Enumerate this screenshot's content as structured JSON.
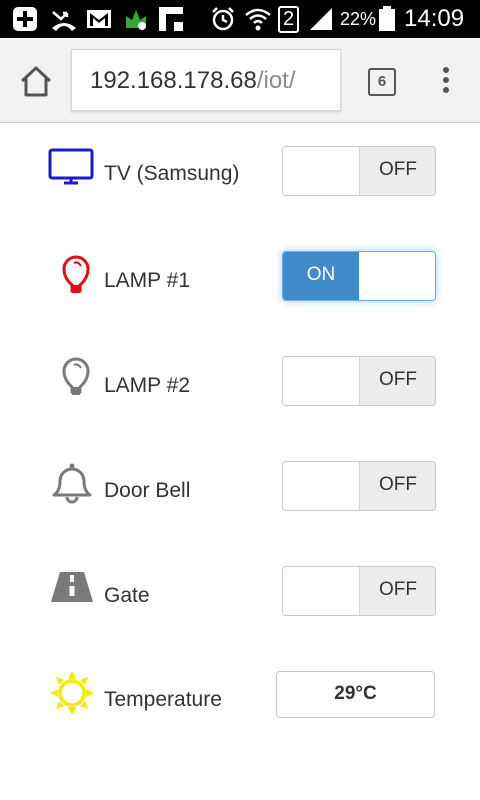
{
  "status_bar": {
    "signal_slot": "2",
    "battery_percent": "22%",
    "time": "14:09"
  },
  "browser": {
    "url_host": "192.168.178.68",
    "url_path": "/iot/",
    "tab_count": "6"
  },
  "devices": [
    {
      "label": "TV (Samsung)",
      "state": "OFF",
      "icon": "tv-icon",
      "icon_color": "#1a1ad6"
    },
    {
      "label": "LAMP #1",
      "state": "ON",
      "icon": "lightbulb-icon",
      "icon_color": "#e01010"
    },
    {
      "label": "LAMP #2",
      "state": "OFF",
      "icon": "lightbulb-icon",
      "icon_color": "#7a7a7a"
    },
    {
      "label": "Door Bell",
      "state": "OFF",
      "icon": "bell-icon",
      "icon_color": "#7a7a7a"
    },
    {
      "label": "Gate",
      "state": "OFF",
      "icon": "road-icon",
      "icon_color": "#7a7a7a"
    }
  ],
  "temperature": {
    "label": "Temperature",
    "value": "29°C",
    "icon": "sun-icon",
    "icon_color": "#f0ee00"
  }
}
